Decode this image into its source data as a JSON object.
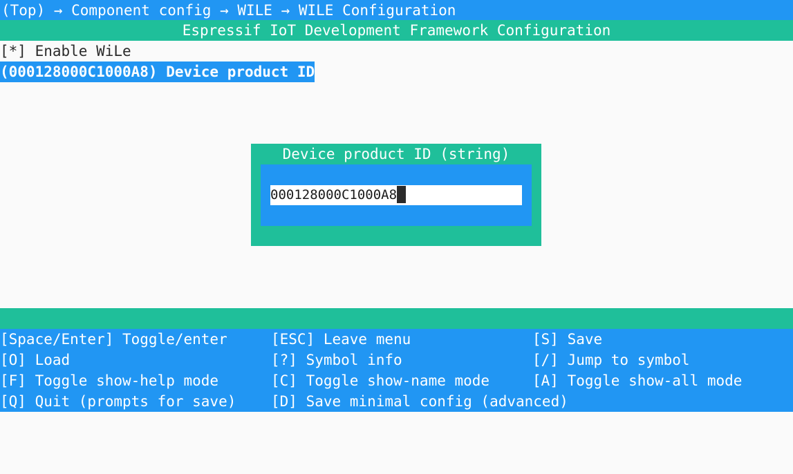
{
  "breadcrumb": "(Top) → Component config → WILE → WILE Configuration",
  "title": "Espressif IoT Development Framework Configuration",
  "menu": {
    "items": [
      {
        "label": "[*] Enable WiLe"
      },
      {
        "label": "(000128000C1000A8) Device product ID"
      }
    ]
  },
  "dialog": {
    "title": "Device product ID (string)",
    "value": "000128000C1000A8"
  },
  "help": {
    "rows": [
      [
        "[Space/Enter] Toggle/enter",
        "[ESC] Leave menu",
        "[S] Save"
      ],
      [
        "[O] Load",
        "[?] Symbol info",
        "[/] Jump to symbol"
      ],
      [
        "[F] Toggle show-help mode",
        "[C] Toggle show-name mode",
        "[A] Toggle show-all mode"
      ],
      [
        "[Q] Quit (prompts for save)",
        "[D] Save minimal config (advanced)",
        ""
      ]
    ]
  },
  "colors": {
    "blue": "#2196f3",
    "green": "#1fbf9a",
    "background": "#fafafa"
  }
}
